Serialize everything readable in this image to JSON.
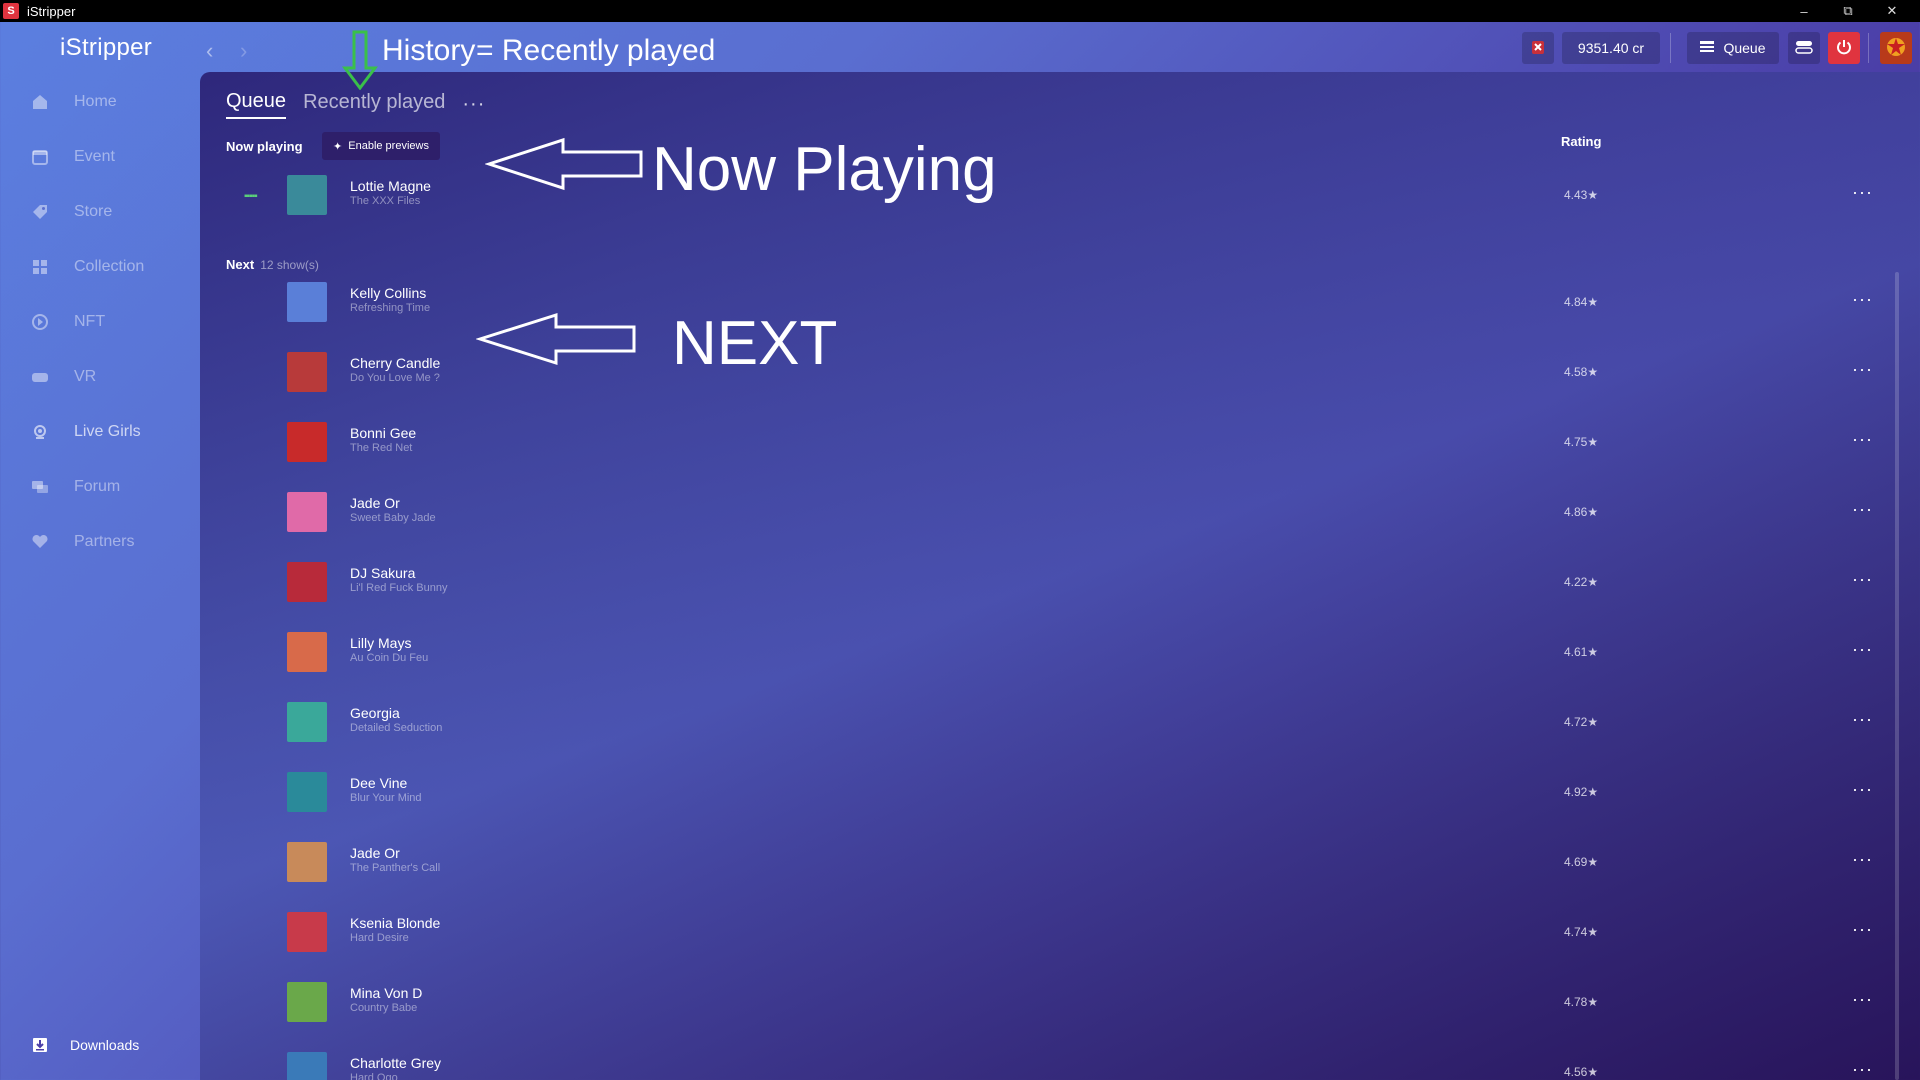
{
  "window": {
    "title": "iStripper"
  },
  "sidebar": {
    "logo": "iStripper",
    "items": [
      {
        "label": "Home",
        "icon": "home-icon"
      },
      {
        "label": "Event",
        "icon": "calendar-icon"
      },
      {
        "label": "Store",
        "icon": "tag-icon"
      },
      {
        "label": "Collection",
        "icon": "grid-icon"
      },
      {
        "label": "NFT",
        "icon": "nft-icon"
      },
      {
        "label": "VR",
        "icon": "vr-headset-icon"
      },
      {
        "label": "Live Girls",
        "icon": "webcam-icon"
      },
      {
        "label": "Forum",
        "icon": "chat-icon"
      },
      {
        "label": "Partners",
        "icon": "heart-icon"
      }
    ],
    "downloads": "Downloads"
  },
  "header": {
    "credits": "9351.40 cr",
    "queue_label": "Queue"
  },
  "tabs": [
    {
      "label": "Queue",
      "active": true
    },
    {
      "label": "Recently played",
      "active": false
    }
  ],
  "tabs_more": "···",
  "now_playing": {
    "label": "Now playing",
    "enable_previews": "Enable previews",
    "rating_header": "Rating",
    "item": {
      "name": "Lottie Magne",
      "show": "The XXX Files",
      "rating": "4.43★",
      "thumb_color": "#3a8a9a"
    }
  },
  "next": {
    "label": "Next",
    "count": "12 show(s)",
    "items": [
      {
        "name": "Kelly Collins",
        "show": "Refreshing Time",
        "rating": "4.84★",
        "thumb_color": "#5a7fd8"
      },
      {
        "name": "Cherry Candle",
        "show": "Do You Love Me ?",
        "rating": "4.58★",
        "thumb_color": "#b83a3a"
      },
      {
        "name": "Bonni Gee",
        "show": "The Red Net",
        "rating": "4.75★",
        "thumb_color": "#c82a2a"
      },
      {
        "name": "Jade Or",
        "show": "Sweet Baby Jade",
        "rating": "4.86★",
        "thumb_color": "#e06aa8"
      },
      {
        "name": "DJ Sakura",
        "show": "Li'l Red Fuck Bunny",
        "rating": "4.22★",
        "thumb_color": "#b82a3a"
      },
      {
        "name": "Lilly Mays",
        "show": "Au Coin Du Feu",
        "rating": "4.61★",
        "thumb_color": "#d86a4a"
      },
      {
        "name": "Georgia",
        "show": "Detailed Seduction",
        "rating": "4.72★",
        "thumb_color": "#3aa89a"
      },
      {
        "name": "Dee Vine",
        "show": "Blur Your Mind",
        "rating": "4.92★",
        "thumb_color": "#2a8a9a"
      },
      {
        "name": "Jade Or",
        "show": "The Panther's Call",
        "rating": "4.69★",
        "thumb_color": "#c88a5a"
      },
      {
        "name": "Ksenia Blonde",
        "show": "Hard Desire",
        "rating": "4.74★",
        "thumb_color": "#c83a4a"
      },
      {
        "name": "Mina Von D",
        "show": "Country Babe",
        "rating": "4.78★",
        "thumb_color": "#6aa84a"
      },
      {
        "name": "Charlotte Grey",
        "show": "Hard Ogo",
        "rating": "4.56★",
        "thumb_color": "#3a7ab8"
      }
    ]
  },
  "annotations": {
    "history_label": "History",
    "history_equals": "= Recently played",
    "now_playing_label": "Now Playing",
    "next_label": "NEXT"
  },
  "colors": {
    "accent_green": "#5bd07a",
    "power_red": "#e0343f",
    "enable_btn": "#2e1f6a"
  }
}
